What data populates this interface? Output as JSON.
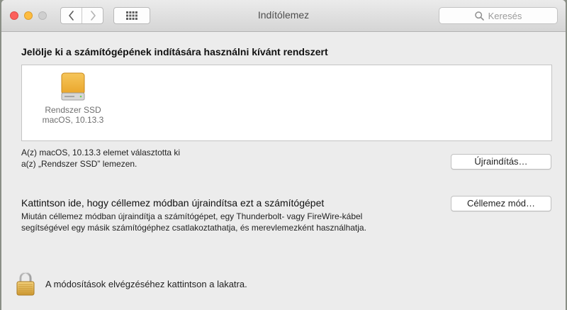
{
  "window": {
    "title": "Indítólemez"
  },
  "search": {
    "placeholder": "Keresés",
    "icon": "magnifier-icon"
  },
  "startup": {
    "heading": "Jelölje ki a számítógépének indítására használni kívánt rendszert",
    "disks": [
      {
        "name": "Rendszer SSD",
        "os": "macOS, 10.13.3",
        "icon": "internal-drive-icon"
      }
    ],
    "selected_line1": "A(z) macOS, 10.13.3 elemet választotta ki",
    "selected_line2": "a(z) „Rendszer SSD” lemezen.",
    "restart_label": "Újraindítás…"
  },
  "target_mode": {
    "title": "Kattintson ide, hogy céllemez módban újraindítsa ezt a számítógépet",
    "desc_line1": "Miután céllemez módban újraindítja a számítógépet, egy Thunderbolt- vagy FireWire-kábel",
    "desc_line2": "segítségével egy másik számítógéphez csatlakoztathatja, és merevlemezként használhatja.",
    "button_label": "Céllemez mód…"
  },
  "lock": {
    "text": "A módosítások elvégzéséhez kattintson a lakatra."
  },
  "colors": {
    "close": "#fc605c",
    "minimize": "#fdbc40",
    "zoom_disabled": "#cfcfcf",
    "drive": "#f0b43a"
  }
}
